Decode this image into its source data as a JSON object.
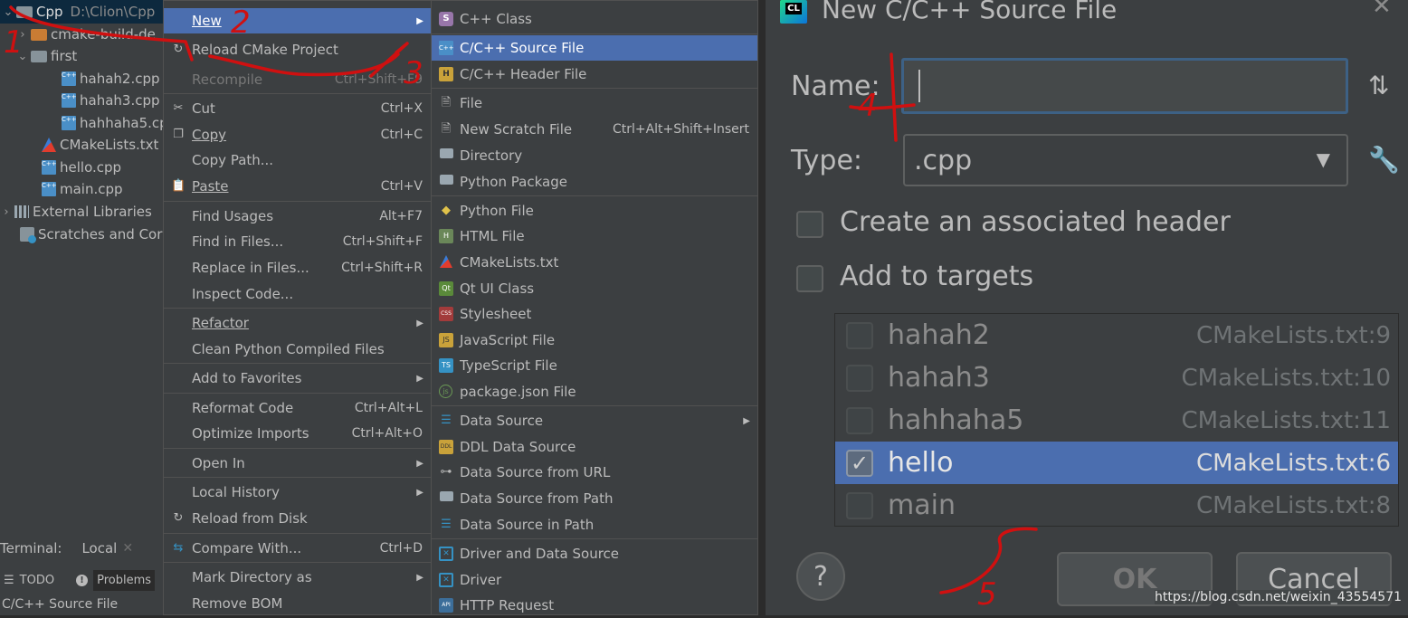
{
  "project": {
    "root_name": "Cpp",
    "root_path": "D:\\Clion\\Cpp",
    "items": [
      {
        "label": "cmake-build-de"
      },
      {
        "label": "first"
      },
      {
        "label": "hahah2.cpp"
      },
      {
        "label": "hahah3.cpp"
      },
      {
        "label": "hahhaha5.cp"
      },
      {
        "label": "CMakeLists.txt"
      },
      {
        "label": "hello.cpp"
      },
      {
        "label": "main.cpp"
      },
      {
        "label": "External Libraries"
      },
      {
        "label": "Scratches and Cor"
      }
    ]
  },
  "bottom": {
    "terminal_label": "Terminal:",
    "terminal_tab": "Local",
    "todo_tab": "TODO",
    "problems_tab": "Problems",
    "status_text": "C/C++ Source File"
  },
  "context_menu": {
    "items": [
      {
        "label": "New"
      },
      {
        "label": "Reload CMake Project"
      },
      {
        "label": "Recompile",
        "shortcut": "Ctrl+Shift+F9"
      },
      {
        "label": "Cut",
        "shortcut": "Ctrl+X"
      },
      {
        "label": "Copy",
        "shortcut": "Ctrl+C"
      },
      {
        "label": "Copy Path..."
      },
      {
        "label": "Paste",
        "shortcut": "Ctrl+V"
      },
      {
        "label": "Find Usages",
        "shortcut": "Alt+F7"
      },
      {
        "label": "Find in Files...",
        "shortcut": "Ctrl+Shift+F"
      },
      {
        "label": "Replace in Files...",
        "shortcut": "Ctrl+Shift+R"
      },
      {
        "label": "Inspect Code..."
      },
      {
        "label": "Refactor"
      },
      {
        "label": "Clean Python Compiled Files"
      },
      {
        "label": "Add to Favorites"
      },
      {
        "label": "Reformat Code",
        "shortcut": "Ctrl+Alt+L"
      },
      {
        "label": "Optimize Imports",
        "shortcut": "Ctrl+Alt+O"
      },
      {
        "label": "Open In"
      },
      {
        "label": "Local History"
      },
      {
        "label": "Reload from Disk"
      },
      {
        "label": "Compare With...",
        "shortcut": "Ctrl+D"
      },
      {
        "label": "Mark Directory as"
      },
      {
        "label": "Remove BOM"
      }
    ]
  },
  "new_submenu": {
    "items": [
      {
        "label": "C++ Class"
      },
      {
        "label": "C/C++ Source File"
      },
      {
        "label": "C/C++ Header File"
      },
      {
        "label": "File"
      },
      {
        "label": "New Scratch File",
        "shortcut": "Ctrl+Alt+Shift+Insert"
      },
      {
        "label": "Directory"
      },
      {
        "label": "Python Package"
      },
      {
        "label": "Python File"
      },
      {
        "label": "HTML File"
      },
      {
        "label": "CMakeLists.txt"
      },
      {
        "label": "Qt UI Class"
      },
      {
        "label": "Stylesheet"
      },
      {
        "label": "JavaScript File"
      },
      {
        "label": "TypeScript File"
      },
      {
        "label": "package.json File"
      },
      {
        "label": "Data Source"
      },
      {
        "label": "DDL Data Source"
      },
      {
        "label": "Data Source from URL"
      },
      {
        "label": "Data Source from Path"
      },
      {
        "label": "Data Source in Path"
      },
      {
        "label": "Driver and Data Source"
      },
      {
        "label": "Driver"
      },
      {
        "label": "HTTP Request"
      }
    ]
  },
  "dialog": {
    "title": "New C/C++ Source File",
    "logo_text": "CL",
    "name_label": "Name:",
    "name_value": "",
    "type_label": "Type:",
    "type_value": ".cpp",
    "create_header_label": "Create an associated header",
    "add_targets_label": "Add to targets",
    "targets": [
      {
        "name": "hahah2",
        "ref": "CMakeLists.txt:9",
        "checked": false
      },
      {
        "name": "hahah3",
        "ref": "CMakeLists.txt:10",
        "checked": false
      },
      {
        "name": "hahhaha5",
        "ref": "CMakeLists.txt:11",
        "checked": false
      },
      {
        "name": "hello",
        "ref": "CMakeLists.txt:6",
        "checked": true
      },
      {
        "name": "main",
        "ref": "CMakeLists.txt:8",
        "checked": false
      }
    ],
    "help_label": "?",
    "ok_label": "OK",
    "cancel_label": "Cancel"
  },
  "annotations": [
    "1",
    "2",
    "3",
    "4",
    "5"
  ],
  "watermark": "https://blog.csdn.net/weixin_43554571",
  "colors": {
    "selection": "#4b6eaf",
    "menu_bg": "#3c3f41",
    "annotation_red": "#d01010"
  }
}
